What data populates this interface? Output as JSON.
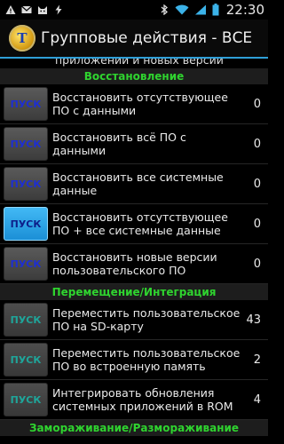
{
  "status": {
    "time": "22:30"
  },
  "app": {
    "title": "Групповые действия - ВСЕ",
    "icon_letter": "T"
  },
  "partial_text": "приложении и новых версии",
  "sections": [
    {
      "title": "Восстановление",
      "rows": [
        {
          "button": "ПУСК",
          "label": "Восстановить отсутствующее ПО с данными",
          "count": "0"
        },
        {
          "button": "ПУСК",
          "label": "Восстановить всё ПО с данными",
          "count": "0"
        },
        {
          "button": "ПУСК",
          "label": "Восстановить все системные данные",
          "count": "0"
        },
        {
          "button": "ПУСК",
          "label": "Восстановить отсутствующее ПО + все системные данные",
          "count": "0"
        },
        {
          "button": "ПУСК",
          "label": "Восстановить новые версии пользовательского ПО",
          "count": "0"
        }
      ]
    },
    {
      "title": "Перемещение/Интеграция",
      "rows": [
        {
          "button": "ПУСК",
          "label": "Переместить пользовательское ПО на SD-карту",
          "count": "43"
        },
        {
          "button": "ПУСК",
          "label": "Переместить пользовательское ПО во встроенную память",
          "count": "2"
        },
        {
          "button": "ПУСК",
          "label": "Интегрировать обновления системных приложений в ROM",
          "count": "4"
        }
      ]
    },
    {
      "title": "Замораживание/Размораживание"
    }
  ]
}
